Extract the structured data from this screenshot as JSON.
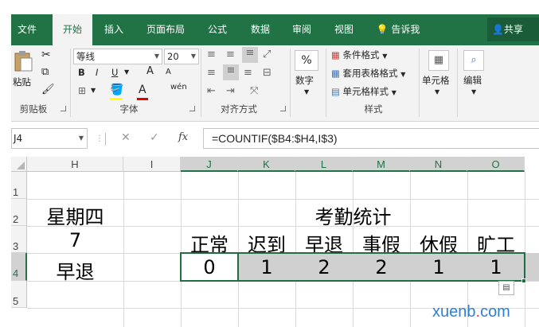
{
  "tabs": [
    {
      "label": "文件",
      "active": false
    },
    {
      "label": "开始",
      "active": true
    },
    {
      "label": "插入",
      "active": false
    },
    {
      "label": "页面布局",
      "active": false
    },
    {
      "label": "公式",
      "active": false
    },
    {
      "label": "数据",
      "active": false
    },
    {
      "label": "审阅",
      "active": false
    },
    {
      "label": "视图",
      "active": false
    },
    {
      "label": "告诉我",
      "active": false
    }
  ],
  "share_label": "共享",
  "ribbon": {
    "clipboard": {
      "paste": "粘贴",
      "group": "剪贴板"
    },
    "font": {
      "name": "等线",
      "size": "20",
      "bold": "B",
      "italic": "I",
      "underline": "U",
      "grow": "A",
      "shrink": "A",
      "font_color": "A",
      "wen": "wén",
      "group": "字体"
    },
    "alignment": {
      "group": "对齐方式"
    },
    "number": {
      "percent": "%",
      "label": "数字"
    },
    "styles": {
      "conditional": "条件格式",
      "table_format": "套用表格格式",
      "cell_style": "单元格样式",
      "group": "样式"
    },
    "cells": {
      "label": "单元格"
    },
    "editing": {
      "label": "编辑"
    }
  },
  "formula_bar": {
    "name_box": "J4",
    "fx": "fx",
    "formula": "=COUNTIF($B4:$H4,I$3)"
  },
  "columns": [
    "H",
    "I",
    "J",
    "K",
    "L",
    "M",
    "N",
    "O"
  ],
  "rows": [
    "1",
    "2",
    "3",
    "4",
    "5"
  ],
  "cells": {
    "H2": "星期四",
    "H3": "7",
    "H4": "早退",
    "J2": "考勤统计",
    "J3": "正常",
    "K3": "迟到",
    "L3": "早退",
    "M3": "事假",
    "N3": "休假",
    "O3": "旷工",
    "J4": "0",
    "K4": "1",
    "L4": "2",
    "M4": "2",
    "N4": "1",
    "O4": "1"
  },
  "watermark": {
    "part1": "xuenb",
    "dot": ".",
    "part2": "com"
  },
  "colors": {
    "accent": "#217346",
    "selection_fill": "#d0d0d0"
  }
}
